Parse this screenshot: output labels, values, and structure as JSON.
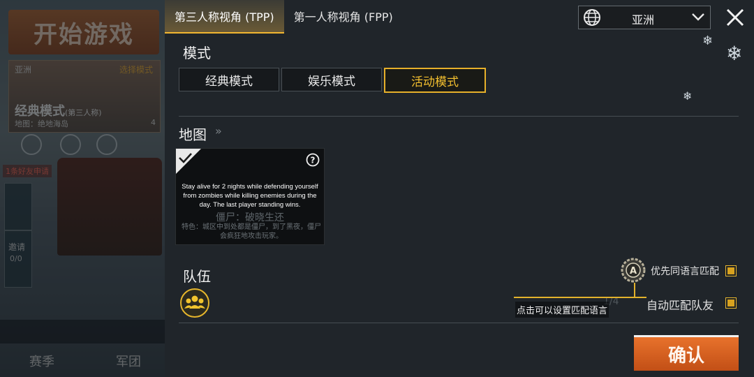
{
  "lobby": {
    "start_label": "开始游戏",
    "region": "亚洲",
    "select_mode": "选择模式",
    "mode_name": "经典模式",
    "mode_perspective": "(第三人称)",
    "map_label": "地图：绝地海岛",
    "squad_count": "4",
    "friend_requests": "1条好友申请",
    "invite_label": "邀请",
    "invite_count": "0/0",
    "bottom_tabs": [
      "赛季",
      "军团"
    ]
  },
  "tabs": [
    {
      "label": "第三人称视角 (TPP)",
      "active": true
    },
    {
      "label": "第一人称视角 (FPP)",
      "active": false
    }
  ],
  "region_select": {
    "value": "亚洲",
    "icon": "globe-icon"
  },
  "sections": {
    "mode_title": "模式",
    "map_title": "地图",
    "team_title": "队伍"
  },
  "modes": [
    {
      "label": "经典模式",
      "selected": false
    },
    {
      "label": "娱乐模式",
      "selected": false
    },
    {
      "label": "活动模式",
      "selected": true
    }
  ],
  "map_card": {
    "description": "Stay alive for 2 nights while defending yourself from zombies while killing enemies during the day. The last player standing wins.",
    "name": "僵尸：破晓生还",
    "feature": "特色：城区中到处都是僵尸，到了黑夜，僵尸会疯狂地攻击玩家。"
  },
  "team": {
    "prefer_same_language": "优先同语言匹配",
    "auto_match": "自动匹配队友",
    "tooltip": "点击可以设置匹配语言",
    "count": "1/4"
  },
  "confirm_label": "确认",
  "colors": {
    "accent": "#e7b02a",
    "confirm": "#d9601f",
    "panel": "#20252a"
  }
}
